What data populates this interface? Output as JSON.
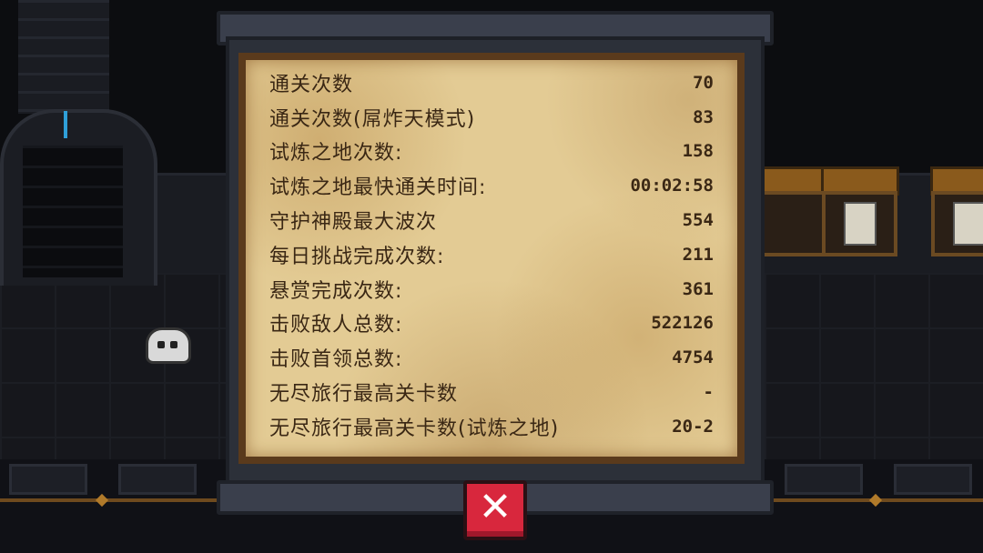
{
  "stats": [
    {
      "label": "通关次数",
      "value": "70"
    },
    {
      "label": "通关次数(屌炸天模式)",
      "value": "83"
    },
    {
      "label": "试炼之地次数:",
      "value": "158"
    },
    {
      "label": "试炼之地最快通关时间:",
      "value": "00:02:58"
    },
    {
      "label": "守护神殿最大波次",
      "value": "554"
    },
    {
      "label": "每日挑战完成次数:",
      "value": "211"
    },
    {
      "label": "悬赏完成次数:",
      "value": "361"
    },
    {
      "label": "击败敌人总数:",
      "value": "522126"
    },
    {
      "label": "击败首领总数:",
      "value": "4754"
    },
    {
      "label": "无尽旅行最高关卡数",
      "value": "-"
    },
    {
      "label": "无尽旅行最高关卡数(试炼之地)",
      "value": "20-2"
    }
  ],
  "close_button": {
    "icon": "close-icon",
    "glyph": "✕"
  },
  "colors": {
    "parchment": "#e3cb94",
    "text": "#3a2714",
    "close_button": "#d8273d",
    "board": "#2c3039"
  }
}
